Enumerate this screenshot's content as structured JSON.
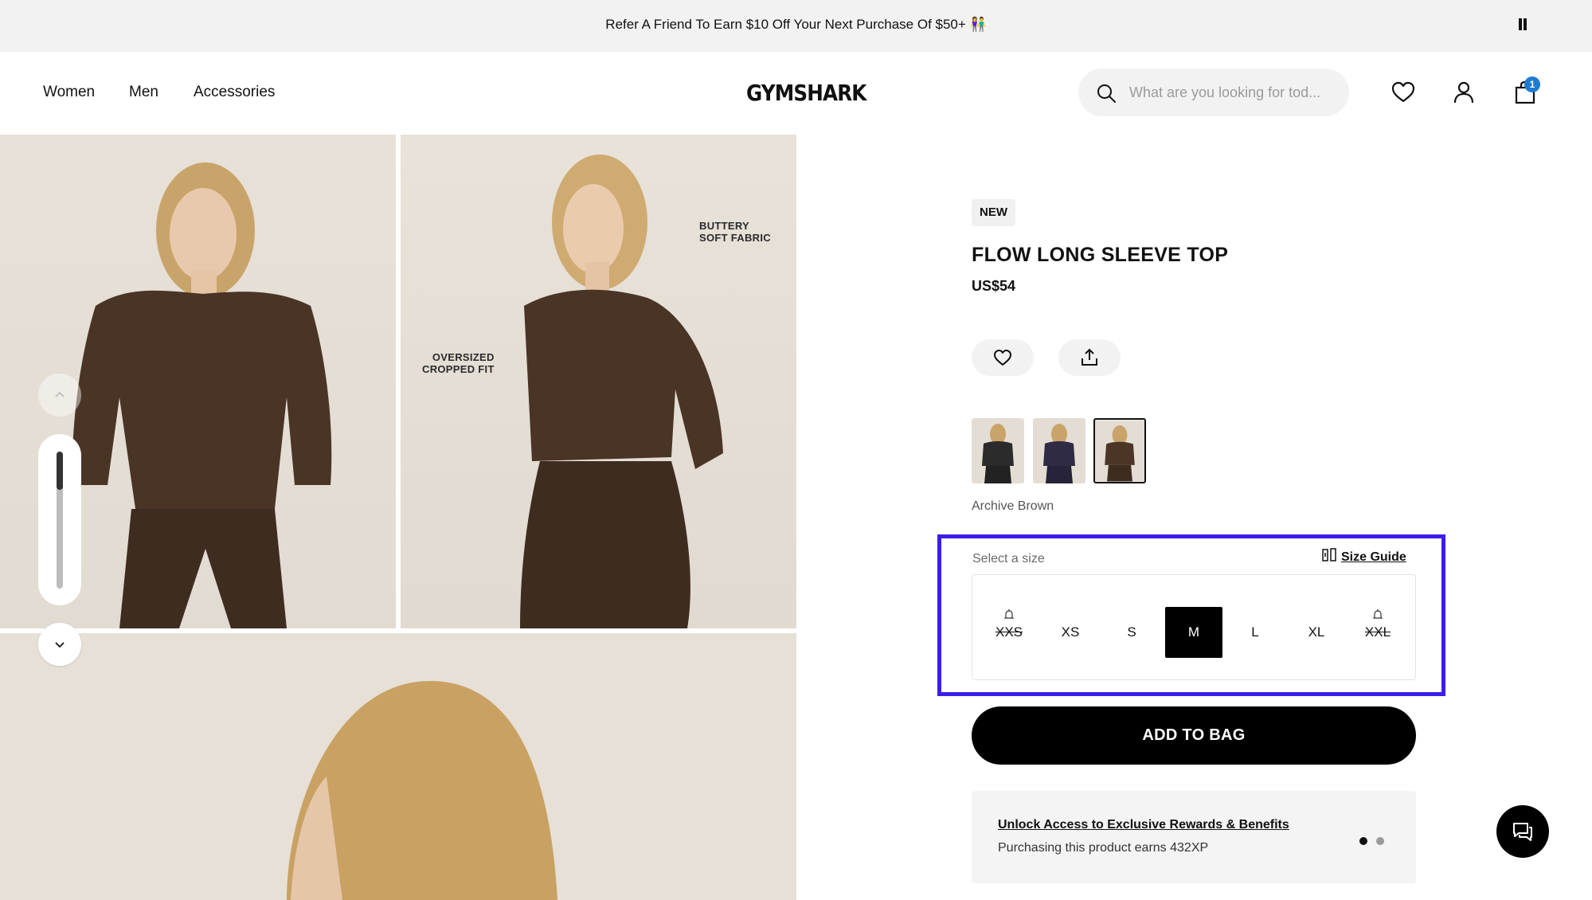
{
  "announcement": {
    "text": "Refer A Friend To Earn $10 Off Your Next Purchase Of $50+ 👫"
  },
  "header": {
    "nav": [
      "Women",
      "Men",
      "Accessories"
    ],
    "logo": "GYMSHARK",
    "search_placeholder": "What are you looking for tod...",
    "cart_count": "1"
  },
  "gallery": {
    "label_fabric_line1": "BUTTERY",
    "label_fabric_line2": "SOFT FABRIC",
    "label_fit_line1": "OVERSIZED",
    "label_fit_line2": "CROPPED FIT",
    "thumbnail_scroll_progress": 0.28
  },
  "product": {
    "badge": "NEW",
    "title": "FLOW LONG SLEEVE TOP",
    "price": "US$54",
    "colour_name": "Archive Brown",
    "colours": [
      {
        "name": "black",
        "swatch": "#2b2b2b"
      },
      {
        "name": "navy",
        "swatch": "#2f2b45"
      },
      {
        "name": "archive-brown",
        "swatch": "#4b3527",
        "selected": true
      }
    ]
  },
  "size_selector": {
    "label": "Select a size",
    "guide_label": "Size Guide",
    "sizes": [
      {
        "label": "XXS",
        "available": false
      },
      {
        "label": "XS",
        "available": true
      },
      {
        "label": "S",
        "available": true
      },
      {
        "label": "M",
        "available": true,
        "selected": true
      },
      {
        "label": "L",
        "available": true
      },
      {
        "label": "XL",
        "available": true
      },
      {
        "label": "XXL",
        "available": false
      }
    ],
    "highlight_color": "#3a1ee8"
  },
  "cta": {
    "add_to_bag": "ADD TO BAG"
  },
  "rewards": {
    "title": "Unlock Access to Exclusive Rewards & Benefits",
    "subtitle": "Purchasing this product earns 432XP",
    "active_slide": 1,
    "slide_count": 2
  },
  "colors": {
    "accent_blue": "#1e7bd1",
    "text": "#111111",
    "panel": "#f2f2f2"
  }
}
